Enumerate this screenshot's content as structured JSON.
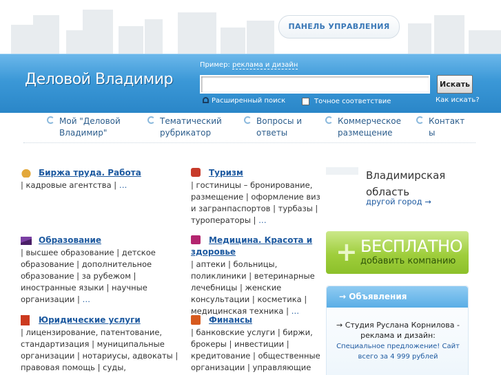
{
  "header": {
    "panel_button": "ПАНЕЛЬ УПРАВЛЕНИЯ",
    "logo": "Деловой Владимир"
  },
  "search": {
    "example_prefix": "Пример:",
    "example_link": "реклама и дизайн",
    "input_value": "",
    "button": "Искать",
    "advanced": "Расширенный поиск",
    "exact_match": "Точное соответствие",
    "how_to": "Как искать?"
  },
  "nav": {
    "items": [
      {
        "line1": "Мой \"Деловой",
        "line2": "Владимир\""
      },
      {
        "line1": "Тематический",
        "line2": "рубрикатор"
      },
      {
        "line1": "Вопросы и",
        "line2": "ответы"
      },
      {
        "line1": "Коммерческое",
        "line2": "размещение"
      },
      {
        "line1": "Контакт",
        "line2": "ы"
      }
    ]
  },
  "categories": [
    {
      "title": "Биржа труда. Работа",
      "desc": "| кадровые агентства | ",
      "more": "…",
      "icon": "briefcase-icon",
      "color": "#c58a1a"
    },
    {
      "title": "Туризм",
      "desc": "| гостиницы – бронирование, размещение | оформление виз и загранпаспортов | турбазы | туроператоры | ",
      "more": "…",
      "icon": "suitcase-icon",
      "color": "#c0392b"
    },
    {
      "title": "Образование",
      "desc": "| высшее образование | детское образование | дополнительное образование | за рубежом | иностранные языки | научные организации | ",
      "more": "…",
      "icon": "graduation-cap-icon",
      "color": "#7a3aa0"
    },
    {
      "title": "Медицина. Красота и здоровье",
      "desc": "| аптеки | больницы, поликлиники | ветеринарные лечебницы | женские консультации | косметика | медицинская техника | ",
      "more": "…",
      "icon": "medical-kit-icon",
      "color": "#b0226e"
    },
    {
      "title": "Юридические услуги",
      "desc": "| лицензирование, патентование, стандартизация | муниципальные организации | нотариусы, адвокаты | правовая помощь | суды, прокуратуры |",
      "more": "",
      "icon": "law-book-icon",
      "color": "#c8321a"
    },
    {
      "title": "Финансы",
      "desc": "| банковские услуги | биржи, брокеры | инвестиции | кредитование | общественные организации | управляющие",
      "more": "",
      "icon": "finance-icon",
      "color": "#d3541b"
    }
  ],
  "region": {
    "name_line1": "Владимирская",
    "name_line2": "область",
    "other_city": "другой город →"
  },
  "free_banner": {
    "plus": "+",
    "line1": "БЕСПЛАТНО",
    "line2": "добавить компанию"
  },
  "ads": {
    "header": "→ Объявления",
    "title": "→ Студия Руслана Корнилова - реклама и дизайн:",
    "text": "Специальное предложение! Сайт всего за 4 999 рублей"
  }
}
